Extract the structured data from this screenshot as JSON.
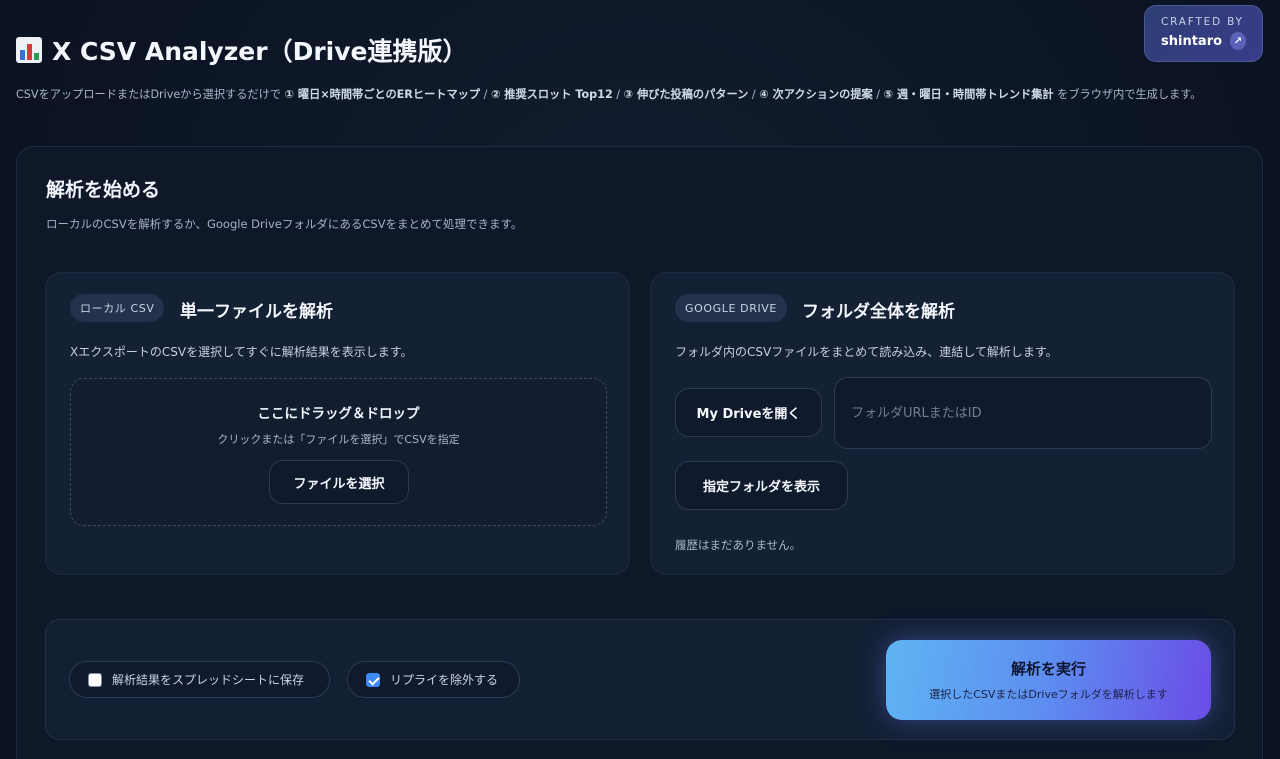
{
  "header": {
    "title": "X CSV Analyzer（Drive連携版）",
    "icon": "bar-chart-icon",
    "description_lead": "CSVをアップロードまたはDriveから選択するだけで",
    "features": [
      "① 曜日×時間帯ごとのERヒートマップ",
      "② 推奨スロット Top12",
      "③ 伸びた投稿のパターン",
      "④ 次アクションの提案",
      "⑤ 週・曜日・時間帯トレンド集計"
    ],
    "description_tail": "をブラウザ内で生成します。",
    "separator": " / "
  },
  "crafted": {
    "label": "CRAFTED BY",
    "name": "shintaro",
    "arrow": "↗"
  },
  "panel": {
    "title": "解析を始める",
    "subtitle": "ローカルのCSVを解析するか、Google DriveフォルダにあるCSVをまとめて処理できます。"
  },
  "local": {
    "pill": "ローカル CSV",
    "title": "単一ファイルを解析",
    "desc": "XエクスポートのCSVを選択してすぐに解析結果を表示します。",
    "drop_title": "ここにドラッグ＆ドロップ",
    "drop_sub": "クリックまたは「ファイルを選択」でCSVを指定",
    "select_button": "ファイルを選択"
  },
  "drive": {
    "pill": "GOOGLE DRIVE",
    "title": "フォルダ全体を解析",
    "desc": "フォルダ内のCSVファイルをまとめて読み込み、連結して解析します。",
    "open_button": "My Driveを開く",
    "folder_placeholder": "フォルダURLまたはID",
    "show_button": "指定フォルダを表示",
    "history": "履歴はまだありません。"
  },
  "options": {
    "save_sheet_label": "解析結果をスプレッドシートに保存",
    "save_sheet_checked": false,
    "exclude_replies_label": "リプライを除外する",
    "exclude_replies_checked": true
  },
  "run": {
    "label": "解析を実行",
    "sub": "選択したCSVまたはDriveフォルダを解析します"
  },
  "colors": {
    "accent": "#3d8af7",
    "gradient_start": "#5fb4f2",
    "gradient_end": "#6a4ce6"
  }
}
